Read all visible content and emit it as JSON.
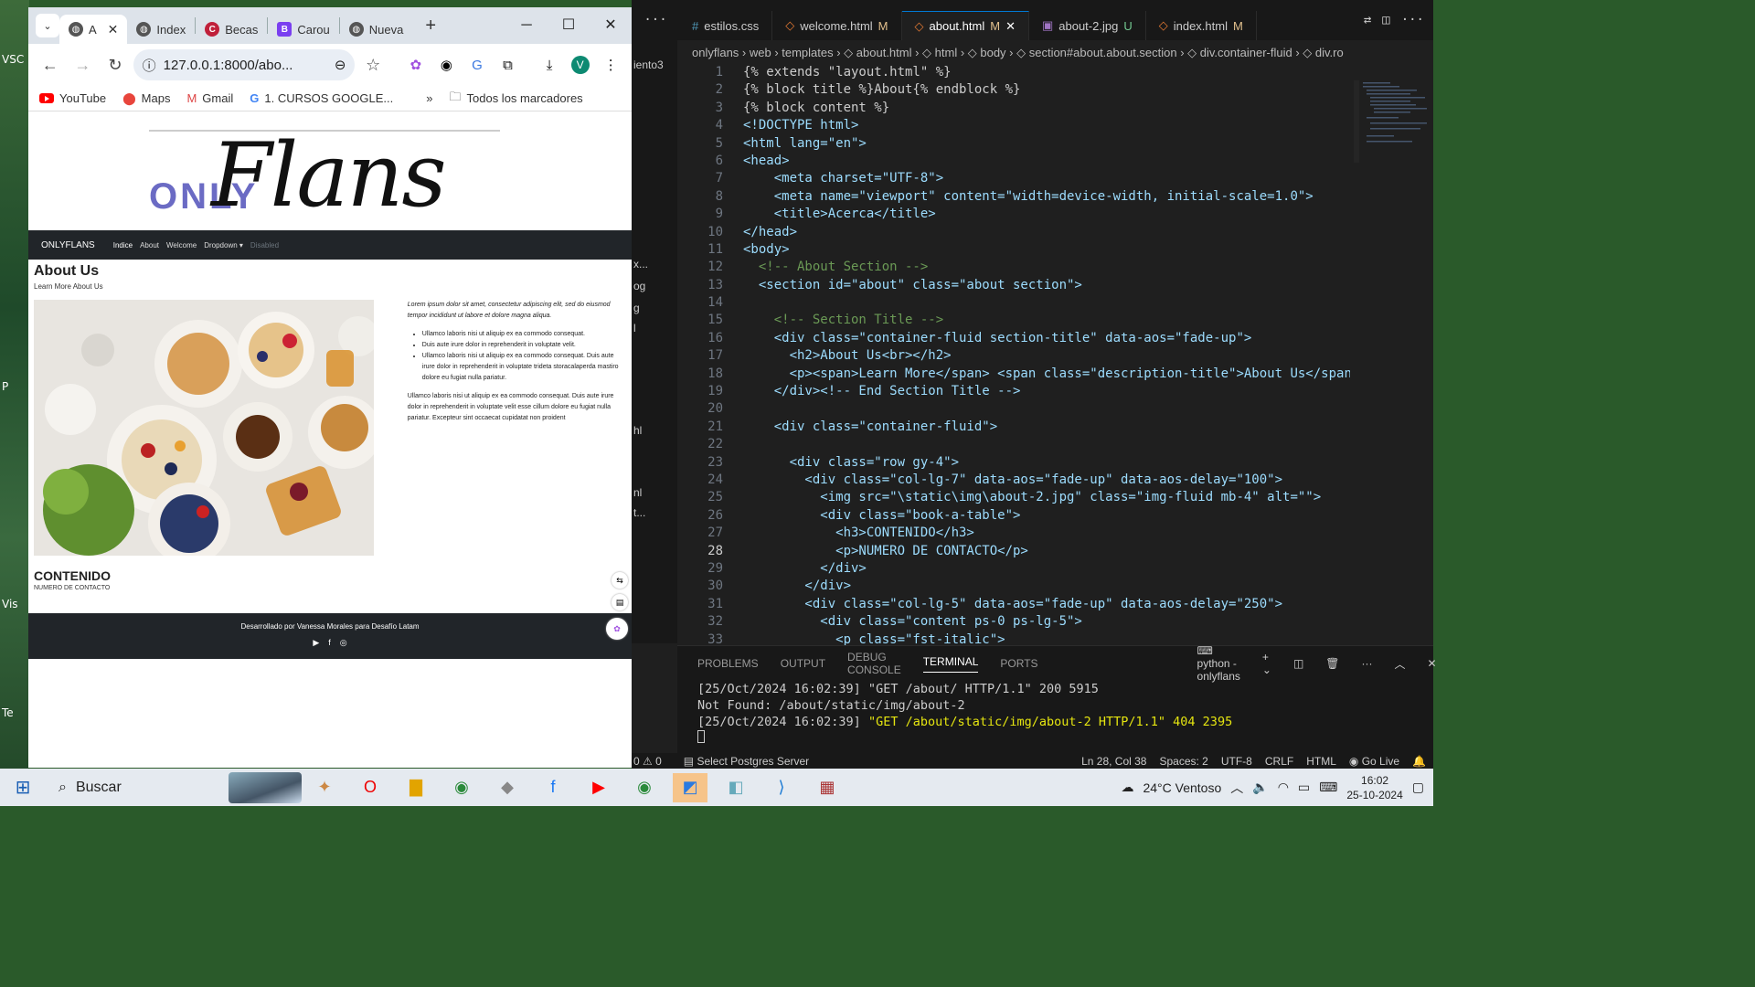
{
  "desktop": {
    "labels": [
      "VSC",
      "P",
      "Vis",
      "Te"
    ]
  },
  "browser": {
    "tabs": [
      {
        "label": "A",
        "active": true
      },
      {
        "label": "Index"
      },
      {
        "label": "Becas"
      },
      {
        "label": "Carou"
      },
      {
        "label": "Nueva"
      }
    ],
    "url": "127.0.0.1:8000/abo...",
    "profile_initial": "V",
    "bookmarks": [
      "YouTube",
      "Maps",
      "Gmail",
      "1. CURSOS GOOGLE..."
    ],
    "all_bookmarks": "Todos los marcadores"
  },
  "site": {
    "logo_only": "ONLY",
    "logo_flans": "Flans",
    "nav": {
      "brand": "ONLYFLANS",
      "items": [
        "Indice",
        "About",
        "Welcome",
        "Dropdown ▾",
        "Disabled"
      ]
    },
    "about_title": "About Us",
    "about_sub": "Learn More About Us",
    "intro": "Lorem ipsum dolor sit amet, consectetur adipiscing elit, sed do eiusmod tempor incididunt ut labore et dolore magna aliqua.",
    "bullets": [
      "Ullamco laboris nisi ut aliquip ex ea commodo consequat.",
      "Duis aute irure dolor in reprehenderit in voluptate velit.",
      "Ullamco laboris nisi ut aliquip ex ea commodo consequat. Duis aute irure dolor in reprehenderit in voluptate trideta storacalaperda mastiro dolore eu fugiat nulla pariatur."
    ],
    "paragraph": "Ullamco laboris nisi ut aliquip ex ea commodo consequat. Duis aute irure dolor in reprehenderit in voluptate velit esse cillum dolore eu fugiat nulla pariatur. Excepteur sint occaecat cupidatat non proident",
    "contenido": "CONTENIDO",
    "contacto": "NUMERO DE CONTACTO",
    "footer": "Desarrollado por Vanessa Morales para Desafío Latam"
  },
  "vscode": {
    "tabs": [
      {
        "name": "estilos.css",
        "badge": ""
      },
      {
        "name": "welcome.html",
        "badge": "M"
      },
      {
        "name": "about.html",
        "badge": "M",
        "active": true
      },
      {
        "name": "about-2.jpg",
        "badge": "U"
      },
      {
        "name": "index.html",
        "badge": "M"
      }
    ],
    "explorer_fragments": [
      "iento3",
      "x...",
      "og",
      "g",
      "l",
      "hl",
      "nl",
      "t..."
    ],
    "breadcrumb": "onlyflans › web › templates › ◇ about.html › ◇ html › ◇ body › ◇ section#about.about.section › ◇ div.container-fluid › ◇ div.ro",
    "code_lines": [
      {
        "n": "1",
        "t": "{% extends \"layout.html\" %}"
      },
      {
        "n": "2",
        "t": "{% block title %}About{% endblock %}"
      },
      {
        "n": "3",
        "t": "{% block content %}"
      },
      {
        "n": "4",
        "t": "<!DOCTYPE html>"
      },
      {
        "n": "5",
        "t": "<html lang=\"en\">"
      },
      {
        "n": "6",
        "t": "<head>"
      },
      {
        "n": "7",
        "t": "    <meta charset=\"UTF-8\">"
      },
      {
        "n": "8",
        "t": "    <meta name=\"viewport\" content=\"width=device-width, initial-scale=1.0\">"
      },
      {
        "n": "9",
        "t": "    <title>Acerca</title>"
      },
      {
        "n": "10",
        "t": "</head>"
      },
      {
        "n": "11",
        "t": "<body>"
      },
      {
        "n": "12",
        "t": "  <!-- About Section -->"
      },
      {
        "n": "13",
        "t": "  <section id=\"about\" class=\"about section\">"
      },
      {
        "n": "14",
        "t": ""
      },
      {
        "n": "15",
        "t": "    <!-- Section Title -->"
      },
      {
        "n": "16",
        "t": "    <div class=\"container-fluid section-title\" data-aos=\"fade-up\">"
      },
      {
        "n": "17",
        "t": "      <h2>About Us<br></h2>"
      },
      {
        "n": "18",
        "t": "      <p><span>Learn More</span> <span class=\"description-title\">About Us</span></p>"
      },
      {
        "n": "19",
        "t": "    </div><!-- End Section Title -->"
      },
      {
        "n": "20",
        "t": ""
      },
      {
        "n": "21",
        "t": "    <div class=\"container-fluid\">"
      },
      {
        "n": "22",
        "t": ""
      },
      {
        "n": "23",
        "t": "      <div class=\"row gy-4\">"
      },
      {
        "n": "24",
        "t": "        <div class=\"col-lg-7\" data-aos=\"fade-up\" data-aos-delay=\"100\">"
      },
      {
        "n": "25",
        "t": "          <img src=\"\\static\\img\\about-2.jpg\" class=\"img-fluid mb-4\" alt=\"\">"
      },
      {
        "n": "26",
        "t": "          <div class=\"book-a-table\">"
      },
      {
        "n": "27",
        "t": "            <h3>CONTENIDO</h3>"
      },
      {
        "n": "28",
        "t": "            <p>NUMERO DE CONTACTO</p>"
      },
      {
        "n": "29",
        "t": "          </div>"
      },
      {
        "n": "30",
        "t": "        </div>"
      },
      {
        "n": "31",
        "t": "        <div class=\"col-lg-5\" data-aos=\"fade-up\" data-aos-delay=\"250\">"
      },
      {
        "n": "32",
        "t": "          <div class=\"content ps-0 ps-lg-5\">"
      },
      {
        "n": "33",
        "t": "            <p class=\"fst-italic\">"
      }
    ],
    "panel_tabs": [
      "PROBLEMS",
      "OUTPUT",
      "DEBUG CONSOLE",
      "TERMINAL",
      "PORTS"
    ],
    "terminal_name": "python - onlyflans",
    "terminal_lines": [
      {
        "text": "[25/Oct/2024 16:02:39] \"GET /about/ HTTP/1.1\" 200 5915",
        "style": "normal"
      },
      {
        "text": "Not Found: /about/static/img/about-2",
        "style": "normal"
      },
      {
        "prefix": "[25/Oct/2024 16:02:39] ",
        "text": "\"GET /about/static/img/about-2 HTTP/1.1\" 404 2395",
        "style": "yellow"
      }
    ],
    "status": {
      "left": "0  ⚠ 0",
      "postgres": "Select Postgres Server",
      "pos": "Ln 28, Col 38",
      "spaces": "Spaces: 2",
      "enc": "UTF-8",
      "eol": "CRLF",
      "lang": "HTML",
      "golive": "Go Live"
    }
  },
  "taskbar": {
    "search": "Buscar",
    "weather": "24°C  Ventoso",
    "time": "16:02",
    "date": "25-10-2024"
  }
}
